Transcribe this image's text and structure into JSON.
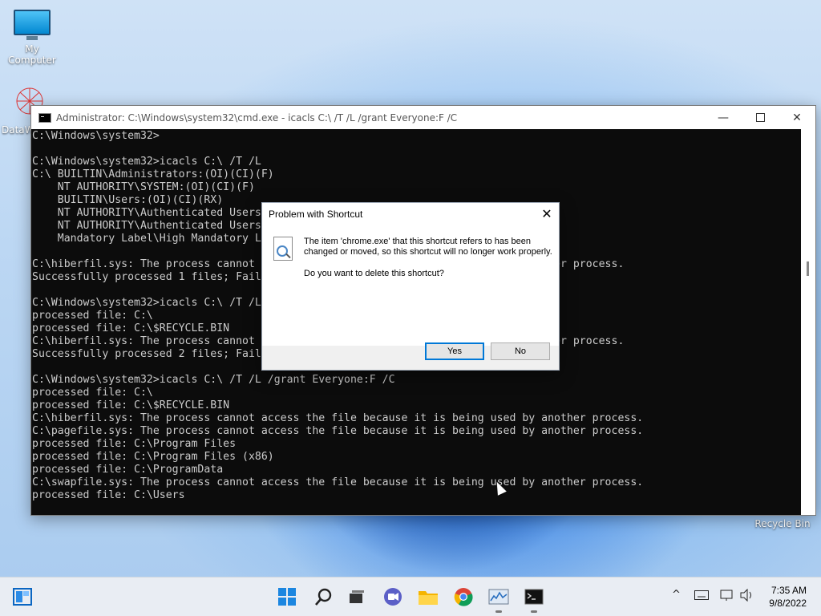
{
  "desktop": {
    "icons": [
      {
        "label": "My Computer"
      },
      {
        "label": "DataW"
      },
      {
        "label": "Recycle Bin"
      }
    ]
  },
  "cmd": {
    "title": "Administrator: C:\\Windows\\system32\\cmd.exe - icacls  C:\\ /T /L /grant Everyone:F /C",
    "lines": [
      "C:\\Windows\\system32>",
      "",
      "C:\\Windows\\system32>icacls C:\\ /T /L",
      "C:\\ BUILTIN\\Administrators:(OI)(CI)(F)",
      "    NT AUTHORITY\\SYSTEM:(OI)(CI)(F)",
      "    BUILTIN\\Users:(OI)(CI)(RX)",
      "    NT AUTHORITY\\Authenticated Users",
      "    NT AUTHORITY\\Authenticated Users",
      "    Mandatory Label\\High Mandatory L",
      "",
      "C:\\hiberfil.sys: The process cannot                                            other process.",
      "Successfully processed 1 files; Fail",
      "",
      "C:\\Windows\\system32>icacls C:\\ /T /L",
      "processed file: C:\\",
      "processed file: C:\\$RECYCLE.BIN",
      "C:\\hiberfil.sys: The process cannot                                            other process.",
      "Successfully processed 2 files; Fail",
      "",
      "C:\\Windows\\system32>icacls C:\\ /T /L /grant Everyone:F /C",
      "processed file: C:\\",
      "processed file: C:\\$RECYCLE.BIN",
      "C:\\hiberfil.sys: The process cannot access the file because it is being used by another process.",
      "C:\\pagefile.sys: The process cannot access the file because it is being used by another process.",
      "processed file: C:\\Program Files",
      "processed file: C:\\Program Files (x86)",
      "processed file: C:\\ProgramData",
      "C:\\swapfile.sys: The process cannot access the file because it is being used by another process.",
      "processed file: C:\\Users"
    ]
  },
  "dialog": {
    "title": "Problem with Shortcut",
    "message": "The item 'chrome.exe' that this shortcut refers to has been changed or moved, so this shortcut will no longer work properly.",
    "question": "Do you want to delete this shortcut?",
    "yes_label": "Yes",
    "no_label": "No"
  },
  "taskbar": {
    "items": [
      {
        "icon": "widgets-icon"
      },
      {
        "icon": "start-icon"
      },
      {
        "icon": "search-icon"
      },
      {
        "icon": "task-view-icon"
      },
      {
        "icon": "chat-icon"
      },
      {
        "icon": "file-explorer-icon"
      },
      {
        "icon": "chrome-icon"
      },
      {
        "icon": "performance-monitor-icon"
      },
      {
        "icon": "command-prompt-icon"
      }
    ],
    "tray_chevron": "^",
    "time": "7:35 AM",
    "date": "9/8/2022"
  }
}
